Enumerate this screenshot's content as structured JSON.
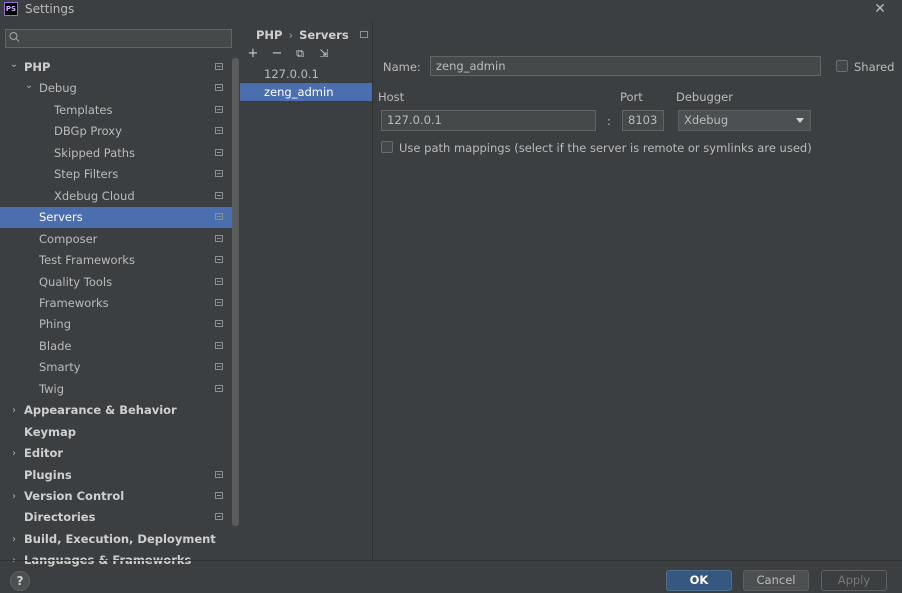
{
  "window": {
    "title": "Settings",
    "app_icon": "PS",
    "close_icon": "✕"
  },
  "search": {
    "placeholder": "",
    "icon": "search-icon"
  },
  "sidebar": {
    "items": [
      {
        "label": "PHP",
        "level": 0,
        "expanded": true,
        "bold": true,
        "project": true
      },
      {
        "label": "Debug",
        "level": 1,
        "expanded": true,
        "project": true
      },
      {
        "label": "Templates",
        "level": 2,
        "project": true
      },
      {
        "label": "DBGp Proxy",
        "level": 2,
        "project": true
      },
      {
        "label": "Skipped Paths",
        "level": 2,
        "project": true
      },
      {
        "label": "Step Filters",
        "level": 2,
        "project": true
      },
      {
        "label": "Xdebug Cloud",
        "level": 2,
        "project": true
      },
      {
        "label": "Servers",
        "level": 1,
        "selected": true,
        "project": true
      },
      {
        "label": "Composer",
        "level": 1,
        "project": true
      },
      {
        "label": "Test Frameworks",
        "level": 1,
        "project": true
      },
      {
        "label": "Quality Tools",
        "level": 1,
        "project": true
      },
      {
        "label": "Frameworks",
        "level": 1,
        "project": true
      },
      {
        "label": "Phing",
        "level": 1,
        "project": true
      },
      {
        "label": "Blade",
        "level": 1,
        "project": true
      },
      {
        "label": "Smarty",
        "level": 1,
        "project": true
      },
      {
        "label": "Twig",
        "level": 1,
        "project": true
      },
      {
        "label": "Appearance & Behavior",
        "level": 0,
        "collapsed": true,
        "bold": true
      },
      {
        "label": "Keymap",
        "level": 0,
        "bold": true
      },
      {
        "label": "Editor",
        "level": 0,
        "collapsed": true,
        "bold": true
      },
      {
        "label": "Plugins",
        "level": 0,
        "bold": true,
        "project": true
      },
      {
        "label": "Version Control",
        "level": 0,
        "collapsed": true,
        "bold": true,
        "project": true
      },
      {
        "label": "Directories",
        "level": 0,
        "bold": true,
        "project": true
      },
      {
        "label": "Build, Execution, Deployment",
        "level": 0,
        "collapsed": true,
        "bold": true
      },
      {
        "label": "Languages & Frameworks",
        "level": 0,
        "collapsed": true,
        "bold": true
      }
    ]
  },
  "breadcrumb": {
    "parent": "PHP",
    "separator": "›",
    "current": "Servers"
  },
  "toolbar": {
    "add": "+",
    "remove": "−",
    "copy": "⧉",
    "import": "⇲"
  },
  "servers": {
    "items": [
      {
        "label": "127.0.0.1"
      },
      {
        "label": "zeng_admin",
        "selected": true
      }
    ]
  },
  "form": {
    "name_label": "Name:",
    "name_value": "zeng_admin",
    "shared_label": "Shared",
    "host_label": "Host",
    "host_value": "127.0.0.1",
    "colon": ":",
    "port_label": "Port",
    "port_value": "8103",
    "debugger_label": "Debugger",
    "debugger_value": "Xdebug",
    "path_mappings_label": "Use path mappings (select if the server is remote or symlinks are used)"
  },
  "footer": {
    "help": "?",
    "ok": "OK",
    "cancel": "Cancel",
    "apply": "Apply"
  },
  "colors": {
    "selection": "#4b6eaf",
    "background": "#3c3f41",
    "ok_button": "#365880"
  }
}
